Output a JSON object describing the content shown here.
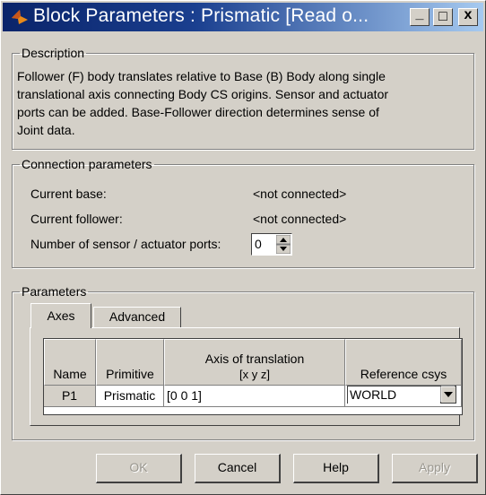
{
  "window": {
    "title": "Block Parameters : Prismatic  [Read o...",
    "minimize_label": "_",
    "maximize_label": "□",
    "close_label": "x"
  },
  "description": {
    "legend": "Description",
    "lines": [
      "Follower (F) body translates relative to Base (B) Body along single",
      "translational axis connecting Body CS origins. Sensor and actuator",
      "ports can be added. Base-Follower direction determines sense of",
      "Joint data."
    ]
  },
  "connection": {
    "legend": "Connection parameters",
    "base_label": "Current base:",
    "base_value": "<not connected>",
    "follower_label": "Current follower:",
    "follower_value": "<not connected>",
    "ports_label": "Number of sensor / actuator ports:",
    "ports_value": "0"
  },
  "parameters": {
    "legend": "Parameters",
    "tabs": [
      "Axes",
      "Advanced"
    ],
    "table": {
      "headers": {
        "name": "Name",
        "primitive": "Primitive",
        "axis_line1": "Axis of translation",
        "axis_line2": "[x y z]",
        "ref": "Reference csys"
      },
      "row": {
        "name": "P1",
        "primitive": "Prismatic",
        "axis": "[0 0 1]",
        "ref": "WORLD"
      }
    }
  },
  "buttons": {
    "ok": "OK",
    "cancel": "Cancel",
    "help": "Help",
    "apply": "Apply"
  },
  "colors": {
    "titlebar_start": "#0a246a",
    "titlebar_end": "#a6caf0",
    "face": "#d4d0c8"
  }
}
